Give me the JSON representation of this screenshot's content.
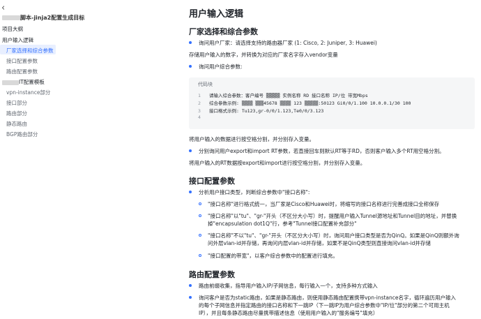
{
  "sidebar": {
    "back_label": "‹",
    "doc_title": "脚本-jinja2配置生成目标",
    "items": [
      {
        "label": "项目大纲",
        "level": 1
      },
      {
        "label": "用户输入逻辑",
        "level": 1
      },
      {
        "label": "厂家选择和综合参数",
        "level": 2,
        "active": true
      },
      {
        "label": "接口配置参数",
        "level": 2
      },
      {
        "label": "路由配置参数",
        "level": 2
      },
      {
        "label": "IT配置模板",
        "level": 1
      },
      {
        "label": "vpn-instance部分",
        "level": 2
      },
      {
        "label": "接口部分",
        "level": 2
      },
      {
        "label": "路由部分",
        "level": 2
      },
      {
        "label": "静态路由",
        "level": 2
      },
      {
        "label": "BGP路由部分",
        "level": 2
      }
    ]
  },
  "main": {
    "title": "用户输入逻辑",
    "sections": {
      "s1_heading": "厂家选择和综合参数",
      "s1_b1": "询问用户厂家：请选择支持的路由器厂家 (1: Cisco, 2: Juniper, 3: Huawei)",
      "s1_p1": "存储用户输入的数字，并转换为对应的厂家名字存入vendor变量",
      "s1_b2": "询问用户综合参数:",
      "code": {
        "header": "代码块",
        "lines": [
          {
            "n": "1",
            "text": "请输入综合参数：客户编号 ▒▒▒▒▒ 实例名称 RD 接口名称 IP/位 带宽Mbps"
          },
          {
            "n": "2",
            "text": "综合参数示例: ▒▒▒▒ ▒▒▒45678 ▒▒▒▒ 123 ▒▒▒▒▒:50123 Gi0/0/1.100 10.0.0.1/30 100"
          },
          {
            "n": "3",
            "text": "接口格式示例: Tu123,gr-0/0/1.123,Te0/0/3.123"
          },
          {
            "n": "4",
            "text": ""
          }
        ]
      },
      "s1_p2": "将用户输入的数据进行按空格分割，并分别存入变量。",
      "s1_b3": "分别询问用户export和import RT参数，若直接回车则默认RT等于RD，否则客户输入多个RT用空格分割。",
      "s1_p3": "将用户输入的RT数据按export和import进行按空格分割，并分别存入变量。",
      "s2_heading": "接口配置参数",
      "s2_b1": "分析用户接口类型，判断综合参数中\"接口名称\":",
      "s2_sub1": "\"接口名称\"进行格式统一，当厂家是Cisco和Huawei时，将缩写的接口名称进行完善成接口全称保存",
      "s2_sub2a": "\"接口名称\"以\"tu\"、\"gr-\"开头（不区分大小写）时，提醒用户输入Tunnel源地址和Tunnel目的地址，并替换",
      "s2_sub2b": "掉\"encapsulation dot1Q\"行，参考\"Tunnel接口配置补充部分\"",
      "s2_sub3a": "\"接口名称\"不以\"tu\"、\"gr-\"开头（不区分大小写）时，询问用户接口类型是否为QinQ。如果是QinQ则额外询",
      "s2_sub3b": "问外层vlan-id并存储，再询问内层vlan-id并存储，如果不是QinQ类型则直接询问vlan-id并存储",
      "s2_sub4": "\"接口配置的带宽\"，以客户综合参数中的配置进行填充。",
      "s3_heading": "路由配置参数",
      "s3_b1": "路由前缀收集，指导用户输入IP/子网信息，每行输入一个，支持多种方式输入",
      "s3_b2a": "询问客户是否为static路由，如果是静态路由，则使用静态路由配置携带vpn-instance名字，循环遍历用户输入",
      "s3_b2b": "的每个子网信息并指定路由的接口名称和下一跳IP（下一跳IP为用户综合参数中\"IP/位\"部分的第二个可用主机",
      "s3_b2c": "IP），并且每条静态路由尽量携带描述信息（使用用户输入的\"服务编号\"填充）"
    }
  },
  "colors": {
    "accent": "#3370ff",
    "active_bg": "#e8efff",
    "code_bg": "#f5f6f7"
  }
}
